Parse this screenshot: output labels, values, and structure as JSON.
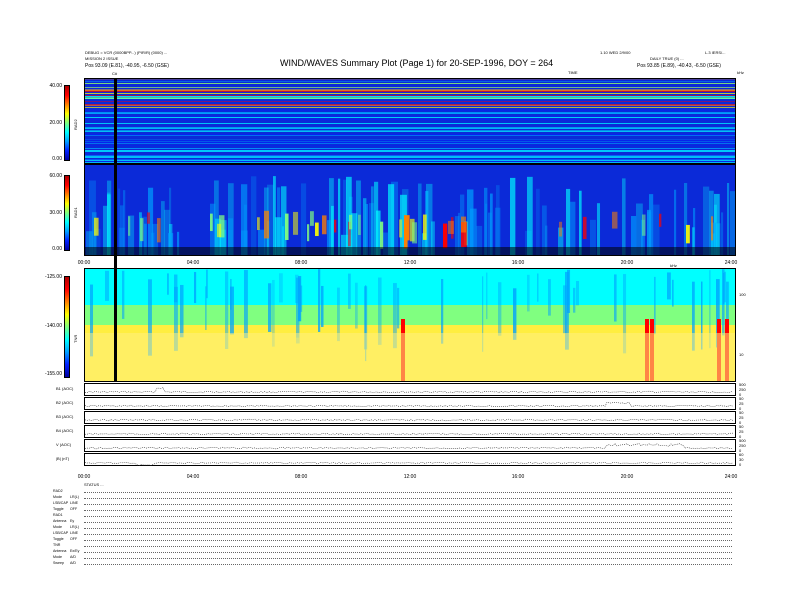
{
  "header": {
    "title": "WIND/WAVES Summary Plot (Page 1) for 20-SEP-1996, DOY = 264",
    "top_left_line1": "DEBUG = VCR (0000BPP...) (PIR/R) (0000) ...",
    "top_left_line2": "MISSION 2 ISSUE",
    "pos_left": "Pos   93.09 (E.81), -40.95, -6.50 (GSE)",
    "top_right_line1": "1.10 WED 2/9/00",
    "top_right_line2": "DAILY  TRUE (0) ...",
    "pos_right": "Pos   93.85 (E.89), -40.43, -6.50 (GSE)",
    "corner_right": "L.3 IERS/...",
    "time_tag": "TIME",
    "hz_tag": "kHz",
    "cursor_label": "C#"
  },
  "colors": {
    "background_blue": "#0b2ad8",
    "spectrum_colormap": [
      "#0000a0",
      "#0020ff",
      "#00a0ff",
      "#00ffff",
      "#80ff80",
      "#ffff00",
      "#ff8000",
      "#ff0000"
    ],
    "cursor": "#000000"
  },
  "chart_data": [
    {
      "type": "heatmap",
      "name": "RAD2",
      "ylabel": "RAD2",
      "color_ticks": [
        "40.00",
        "20.00",
        "0.00"
      ],
      "ylim": [
        0,
        40
      ]
    },
    {
      "type": "heatmap",
      "name": "RAD1",
      "ylabel": "RAD1",
      "color_ticks": [
        "60.00",
        "30.00",
        "0.00"
      ],
      "ylim": [
        0,
        60
      ],
      "x_ticks": [
        "00:00",
        "04:00",
        "08:00",
        "12:00",
        "16:00",
        "20:00",
        "24:00"
      ]
    },
    {
      "type": "heatmap",
      "name": "TNR",
      "ylabel": "TNR",
      "color_ticks": [
        "-125.00",
        "-140.00",
        "-155.00"
      ],
      "ylim": [
        -155,
        -125
      ],
      "right_ticks": [
        "100",
        "10"
      ],
      "right_unit": "kHz"
    },
    {
      "type": "line",
      "tracks": [
        {
          "label": "B1 (AOC)",
          "right_ticks": [
            "500",
            "250",
            "0"
          ]
        },
        {
          "label": "B2 (AOC)",
          "right_ticks": [
            "50",
            "25",
            "0"
          ]
        },
        {
          "label": "B3 (AOC)",
          "right_ticks": [
            "50",
            "25",
            "0"
          ]
        },
        {
          "label": "B4 (AOC)",
          "right_ticks": [
            "50",
            "25",
            "0"
          ]
        },
        {
          "label": "V (AOC)",
          "right_ticks": [
            "500",
            "250",
            "0"
          ]
        },
        {
          "label": "|B| (nT)",
          "right_ticks": [
            "60",
            "30",
            "0"
          ]
        }
      ],
      "x_ticks": [
        "00:00",
        "04:00",
        "08:00",
        "12:00",
        "16:00",
        "20:00",
        "24:00"
      ]
    }
  ],
  "status": {
    "header": "STATUS ...",
    "rows": [
      {
        "name": "RAD2",
        "value": ""
      },
      {
        "name": "Mode",
        "value": "LR(L)"
      },
      {
        "name": "LSB/CAP",
        "value": "LINE"
      },
      {
        "name": "Toggle",
        "value": "OFF"
      },
      {
        "name": "RAD1",
        "value": ""
      },
      {
        "name": "Antenna",
        "value": "Ey"
      },
      {
        "name": "Mode",
        "value": "LR(L)"
      },
      {
        "name": "LSB/CAP",
        "value": "LINE"
      },
      {
        "name": "Toggle",
        "value": "OFF"
      },
      {
        "name": "TNR",
        "value": ""
      },
      {
        "name": "Antenna",
        "value": "Ex/Ey"
      },
      {
        "name": "Mode",
        "value": "A/D"
      },
      {
        "name": "Sweep",
        "value": "A/D"
      }
    ]
  }
}
